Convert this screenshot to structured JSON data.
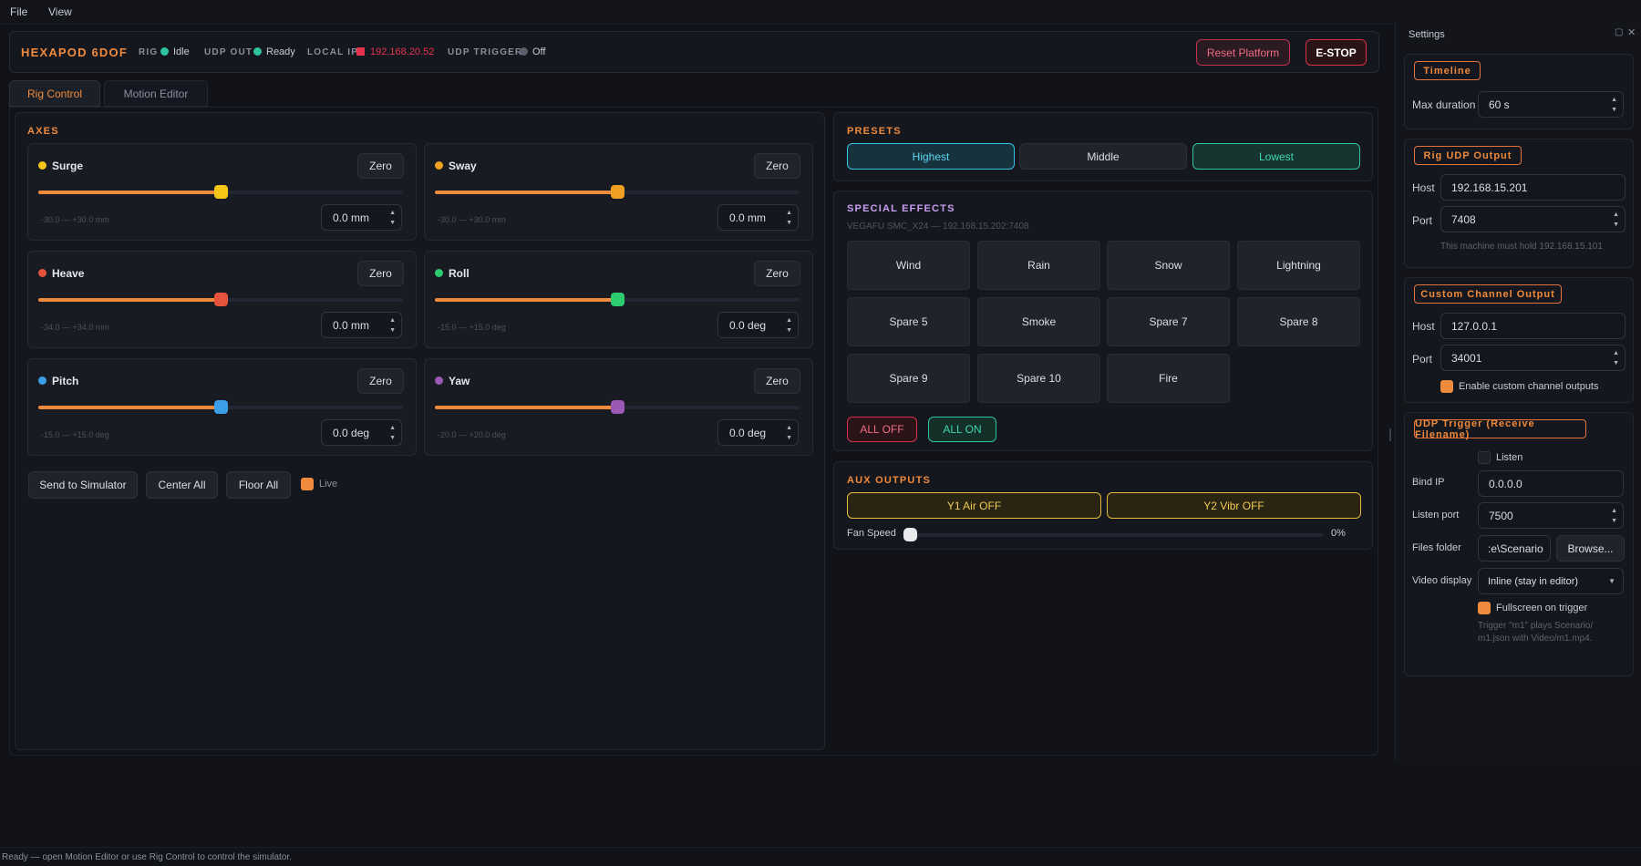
{
  "menubar": {
    "file": "File",
    "view": "View"
  },
  "header": {
    "brand": "HEXAPOD 6DOF",
    "rig_label": "RIG",
    "rig_value": "Idle",
    "udp_out_label": "UDP OUT",
    "udp_out_value": "Ready",
    "local_ip_label": "LOCAL IP",
    "local_ip_value": "192.168.20.52",
    "udp_trigger_label": "UDP TRIGGER",
    "udp_trigger_value": "Off",
    "reset_button": "Reset Platform",
    "estop_button": "E-STOP"
  },
  "tabs": [
    "Rig Control",
    "Motion Editor"
  ],
  "axes": {
    "title": "AXES",
    "zero_label": "Zero",
    "items": [
      {
        "name": "Surge",
        "color": "#f5c518",
        "value": "0.0 mm",
        "range": "-30.0 — +30.0 mm",
        "position": 0.5
      },
      {
        "name": "Sway",
        "color": "#f0a020",
        "value": "0.0 mm",
        "range": "-30.0 — +30.0 mm",
        "position": 0.5
      },
      {
        "name": "Heave",
        "color": "#e5533c",
        "value": "0.0 mm",
        "range": "-34.0 — +34.0 mm",
        "position": 0.5
      },
      {
        "name": "Roll",
        "color": "#2ecc71",
        "value": "0.0 deg",
        "range": "-15.0 — +15.0 deg",
        "position": 0.5
      },
      {
        "name": "Pitch",
        "color": "#3a9ee8",
        "value": "0.0 deg",
        "range": "-15.0 — +15.0 deg",
        "position": 0.5
      },
      {
        "name": "Yaw",
        "color": "#9b59b6",
        "value": "0.0 deg",
        "range": "-20.0 — +20.0 deg",
        "position": 0.5
      }
    ],
    "send_button": "Send to Simulator",
    "center_button": "Center All",
    "floor_button": "Floor All",
    "live_label": "Live"
  },
  "presets": {
    "title": "PRESETS",
    "highest": "Highest",
    "middle": "Middle",
    "lowest": "Lowest"
  },
  "effects": {
    "title": "SPECIAL EFFECTS",
    "device": "VEGAFU SMC_X24 — 192.168.15.202:7408",
    "buttons": [
      "Wind",
      "Rain",
      "Snow",
      "Lightning",
      "Spare 5",
      "Smoke",
      "Spare 7",
      "Spare 8",
      "Spare 9",
      "Spare 10",
      "Fire"
    ],
    "all_off": "ALL OFF",
    "all_on": "ALL ON"
  },
  "aux": {
    "title": "AUX OUTPUTS",
    "y1": "Y1 Air OFF",
    "y2": "Y2 Vibr OFF",
    "fan_label": "Fan Speed",
    "fan_value": "0%",
    "fan_level": 0
  },
  "settings": {
    "title": "Settings",
    "timeline": {
      "title": "Timeline",
      "max_duration_label": "Max duration",
      "max_duration_value": "60 s"
    },
    "rig_udp": {
      "title": "Rig UDP Output",
      "host_label": "Host",
      "host_value": "192.168.15.201",
      "port_label": "Port",
      "port_value": "7408",
      "note": "This machine must hold 192.168.15.101"
    },
    "custom": {
      "title": "Custom Channel Output",
      "host_label": "Host",
      "host_value": "127.0.0.1",
      "port_label": "Port",
      "port_value": "34001",
      "enable_label": "Enable custom channel outputs"
    },
    "trigger": {
      "title": "UDP Trigger (Receive Filename)",
      "listen_label": "Listen",
      "bind_ip_label": "Bind IP",
      "bind_ip_value": "0.0.0.0",
      "listen_port_label": "Listen port",
      "listen_port_value": "7500",
      "files_folder_label": "Files folder",
      "files_folder_value": ":e\\Scenario",
      "browse_button": "Browse...",
      "video_display_label": "Video display",
      "video_display_value": "Inline (stay in editor)",
      "fullscreen_label": "Fullscreen on trigger",
      "note_line1": "Trigger \"m1\" plays Scenario/",
      "note_line2": "m1.json with Video/m1.mp4."
    }
  },
  "status_bar": "Ready — open Motion Editor or use Rig Control to control the simulator.",
  "colors": {
    "accent": "#f08a3c",
    "cyan": "#33c4e8",
    "teal": "#2ec4a0",
    "red": "#e5334f",
    "yellow": "#e6b93a",
    "purple": "#c99df0"
  }
}
